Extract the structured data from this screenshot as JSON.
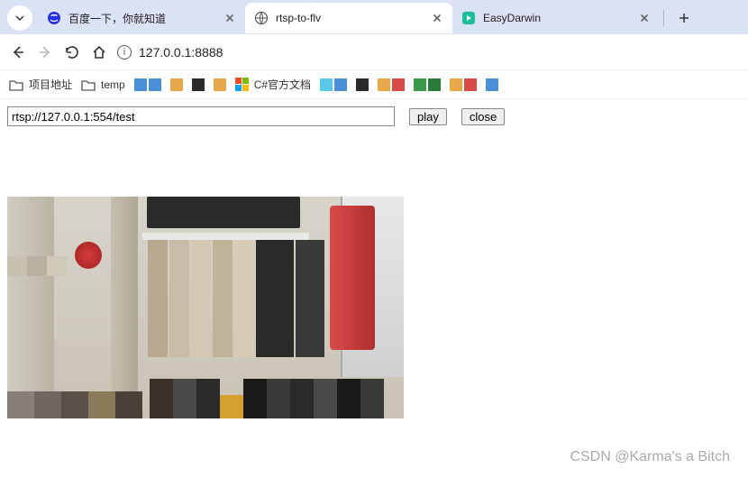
{
  "tabs": {
    "dropdown": true,
    "items": [
      {
        "label": "百度一下，你就知道",
        "active": false,
        "icon": "baidu"
      },
      {
        "label": "rtsp-to-flv",
        "active": true,
        "icon": "globe"
      },
      {
        "label": "EasyDarwin",
        "active": false,
        "icon": "easydarwin"
      }
    ],
    "newtab": "+"
  },
  "toolbar": {
    "url": "127.0.0.1:8888"
  },
  "bookmarks": {
    "items": [
      {
        "type": "folder",
        "label": "项目地址"
      },
      {
        "type": "folder",
        "label": "temp"
      },
      {
        "type": "swatch",
        "colors": [
          "#4a90d9",
          "#4a90d9"
        ]
      },
      {
        "type": "swatch",
        "colors": [
          "#e8a84a"
        ]
      },
      {
        "type": "swatch",
        "colors": [
          "#2a2a2a"
        ]
      },
      {
        "type": "swatch",
        "colors": [
          "#e8a84a"
        ]
      },
      {
        "type": "ms",
        "label": "C#官方文档"
      },
      {
        "type": "swatch",
        "colors": [
          "#5ac8e8",
          "#4a90d9"
        ]
      },
      {
        "type": "swatch",
        "colors": [
          "#2a2a2a"
        ]
      },
      {
        "type": "swatch",
        "colors": [
          "#e8a84a",
          "#d94a4a"
        ]
      },
      {
        "type": "swatch",
        "colors": [
          "#3a9a4a",
          "#2a7a3a"
        ]
      },
      {
        "type": "swatch",
        "colors": [
          "#e8a84a",
          "#d94a4a"
        ]
      },
      {
        "type": "swatch",
        "colors": [
          "#4a90d9"
        ]
      }
    ]
  },
  "page": {
    "input_value": "rtsp://127.0.0.1:554/test",
    "play_label": "play",
    "close_label": "close"
  },
  "watermark": "CSDN @Karma's a Bitch"
}
